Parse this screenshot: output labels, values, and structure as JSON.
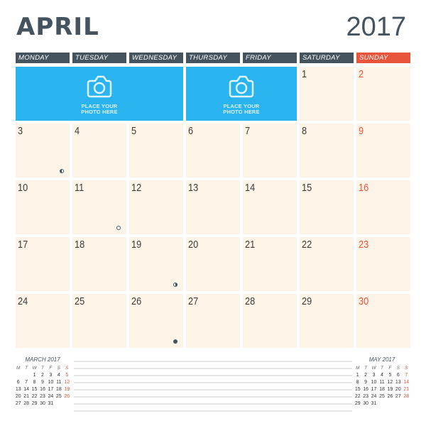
{
  "header": {
    "month": "APRIL",
    "year": "2017"
  },
  "weekdays": [
    {
      "label": "MONDAY"
    },
    {
      "label": "TUESDAY"
    },
    {
      "label": "WEDNESDAY"
    },
    {
      "label": "THURSDAY"
    },
    {
      "label": "FRIDAY"
    },
    {
      "label": "SATURDAY"
    },
    {
      "label": "SUNDAY"
    }
  ],
  "colors": {
    "header": "#45535e",
    "sunday": "#e8553d",
    "photo": "#29b4f0",
    "cell": "#fdf3e6"
  },
  "photo_placeholders": [
    {
      "icon": "camera-icon",
      "line1": "PLACE YOUR",
      "line2": "PHOTO HERE"
    },
    {
      "icon": "camera-icon",
      "line1": "PLACE YOUR",
      "line2": "PHOTO HERE"
    }
  ],
  "days": [
    {
      "n": "1"
    },
    {
      "n": "2"
    },
    {
      "n": "3",
      "moon": "last-quarter"
    },
    {
      "n": "4"
    },
    {
      "n": "5"
    },
    {
      "n": "6"
    },
    {
      "n": "7"
    },
    {
      "n": "8"
    },
    {
      "n": "9"
    },
    {
      "n": "10"
    },
    {
      "n": "11",
      "moon": "full"
    },
    {
      "n": "12"
    },
    {
      "n": "13"
    },
    {
      "n": "14"
    },
    {
      "n": "15"
    },
    {
      "n": "16"
    },
    {
      "n": "17"
    },
    {
      "n": "18"
    },
    {
      "n": "19",
      "moon": "first-quarter"
    },
    {
      "n": "20"
    },
    {
      "n": "21"
    },
    {
      "n": "22"
    },
    {
      "n": "23"
    },
    {
      "n": "24"
    },
    {
      "n": "25"
    },
    {
      "n": "26",
      "moon": "new"
    },
    {
      "n": "27"
    },
    {
      "n": "28"
    },
    {
      "n": "29"
    },
    {
      "n": "30"
    }
  ],
  "mini_calendars": [
    {
      "title": "MARCH 2017",
      "weekday_initials": [
        "M",
        "T",
        "W",
        "T",
        "F",
        "S",
        "S"
      ],
      "weeks": [
        [
          "",
          "",
          "1",
          "2",
          "3",
          "4",
          "5"
        ],
        [
          "6",
          "7",
          "8",
          "9",
          "10",
          "11",
          "12"
        ],
        [
          "13",
          "14",
          "15",
          "16",
          "17",
          "18",
          "19"
        ],
        [
          "20",
          "21",
          "22",
          "23",
          "24",
          "25",
          "26"
        ],
        [
          "27",
          "28",
          "29",
          "30",
          "31",
          "",
          ""
        ]
      ]
    },
    {
      "title": "MAY 2017",
      "weekday_initials": [
        "M",
        "T",
        "W",
        "T",
        "F",
        "S",
        "S"
      ],
      "weeks": [
        [
          "1",
          "2",
          "3",
          "4",
          "5",
          "6",
          "7"
        ],
        [
          "8",
          "9",
          "10",
          "11",
          "12",
          "13",
          "14"
        ],
        [
          "15",
          "16",
          "17",
          "18",
          "19",
          "20",
          "21"
        ],
        [
          "22",
          "23",
          "24",
          "25",
          "26",
          "27",
          "28"
        ],
        [
          "29",
          "30",
          "31",
          "",
          "",
          "",
          ""
        ]
      ]
    }
  ],
  "notes": {
    "line_count": 8
  }
}
